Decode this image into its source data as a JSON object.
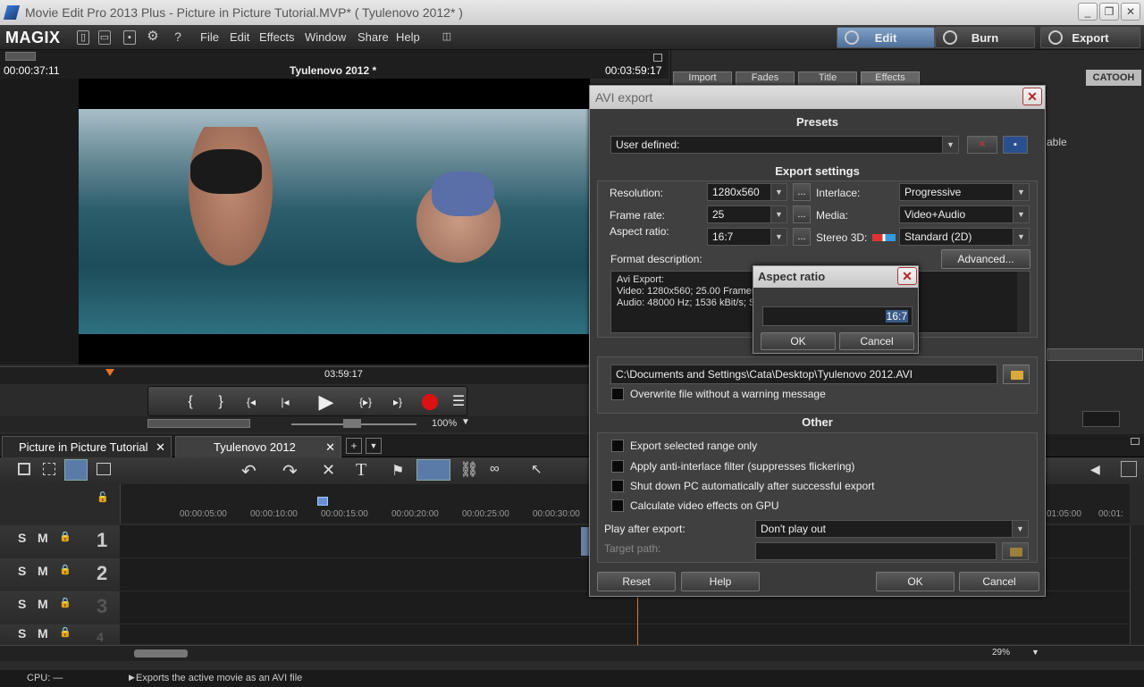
{
  "window": {
    "title": "Movie Edit Pro 2013 Plus - Picture in Picture Tutorial.MVP* ( Tyulenovo 2012* )",
    "minimize": "_",
    "restore": "❐",
    "close": "✕"
  },
  "menubar": {
    "logo": "MAGIX",
    "items": [
      "File",
      "Edit",
      "Effects",
      "Window",
      "Share",
      "Help"
    ],
    "modes": {
      "edit": "Edit",
      "burn": "Burn",
      "export": "Export"
    }
  },
  "preview": {
    "time_left": "00:00:37:11",
    "title": "Tyulenovo 2012 *",
    "time_right": "00:03:59:17",
    "ruler_time": "03:59:17",
    "zoom": "100%"
  },
  "right_panel": {
    "tabs": [
      "Import",
      "Fades",
      "Title",
      "Effects"
    ],
    "brand": "CATOOH",
    "partial_text": "able"
  },
  "project_tabs": [
    "Picture in Picture Tutorial",
    "Tyulenovo 2012"
  ],
  "timeline": {
    "ticks": [
      "00:00:05:00",
      "00:00:10:00",
      "00:00:15:00",
      "00:00:20:00",
      "00:00:25:00",
      "00:00:30:00",
      "01:05:00",
      "00:01:"
    ],
    "tracks": [
      {
        "s": "S",
        "m": "M",
        "num": "1"
      },
      {
        "s": "S",
        "m": "M",
        "num": "2"
      },
      {
        "s": "S",
        "m": "M",
        "num": "3"
      },
      {
        "s": "S",
        "m": "M",
        "num": "4"
      }
    ],
    "zoom_pct": "29%"
  },
  "status": {
    "cpu": "CPU: —",
    "message": "Exports the active movie as an AVI file"
  },
  "avi_dialog": {
    "title": "AVI export",
    "presets_header": "Presets",
    "preset_value": "User defined:",
    "export_settings_header": "Export settings",
    "resolution_label": "Resolution:",
    "resolution_value": "1280x560",
    "framerate_label": "Frame rate:",
    "framerate_value": "25",
    "aspect_label": "Aspect ratio:",
    "aspect_value": "16:7",
    "interlace_label": "Interlace:",
    "interlace_value": "Progressive",
    "media_label": "Media:",
    "media_value": "Video+Audio",
    "stereo_label": "Stereo 3D:",
    "stereo_value": "Standard (2D)",
    "format_label": "Format description:",
    "advanced_button": "Advanced...",
    "format_lines": [
      "Avi Export:",
      "Video: 1280x560; 25.00 Frames",
      "Audio: 48000 Hz; 1536 kBit/s; S"
    ],
    "file_header": "Fil",
    "file_path": "C:\\Documents and Settings\\Cata\\Desktop\\Tyulenovo 2012.AVI",
    "overwrite_label": "Overwrite file without a warning message",
    "other_header": "Other",
    "options": [
      "Export selected range only",
      "Apply anti-interlace filter (suppresses flickering)",
      "Shut down PC automatically after successful export",
      "Calculate video effects on GPU"
    ],
    "play_after_label": "Play after export:",
    "play_after_value": "Don't play out",
    "target_path_label": "Target path:",
    "reset_button": "Reset",
    "help_button": "Help",
    "ok_button": "OK",
    "cancel_button": "Cancel",
    "ellipsis": "..."
  },
  "aspect_dialog": {
    "title": "Aspect ratio",
    "value": "16:7",
    "ok_button": "OK",
    "cancel_button": "Cancel"
  }
}
